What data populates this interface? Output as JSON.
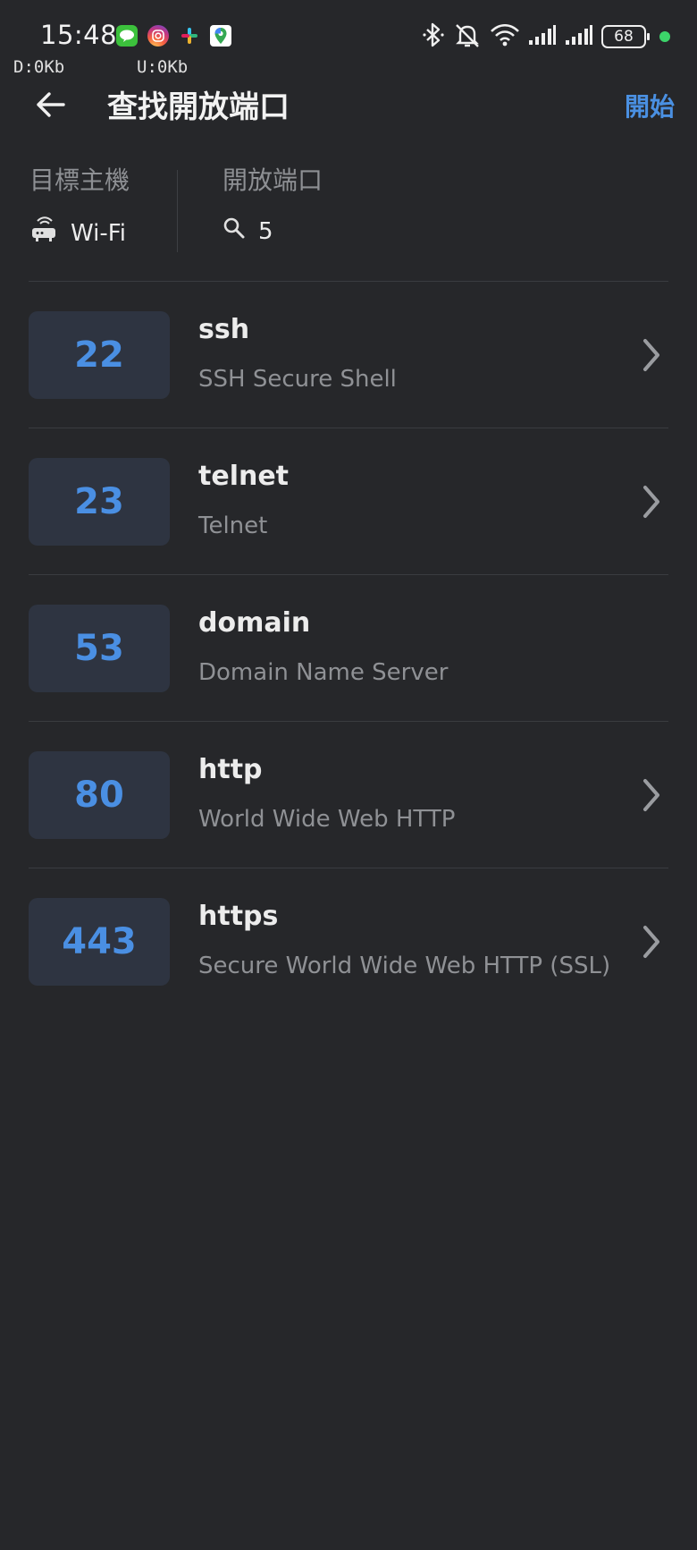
{
  "status_bar": {
    "time": "15:48",
    "battery": "68",
    "download_speed": "D:0Kb",
    "upload_speed": "U:0Kb",
    "notification_icons": [
      "line-icon",
      "instagram-icon",
      "slack-icon",
      "google-maps-icon"
    ],
    "system_icons": [
      "bluetooth-icon",
      "alarm-off-icon",
      "wifi-icon",
      "signal-icon",
      "signal-icon"
    ]
  },
  "app_bar": {
    "title": "查找開放端口",
    "action": "開始"
  },
  "info": {
    "target_label": "目標主機",
    "target_value": "Wi-Fi",
    "open_ports_label": "開放端口",
    "open_ports_value": "5"
  },
  "ports": [
    {
      "port": "22",
      "name": "ssh",
      "description": "SSH Secure Shell",
      "has_chevron": true
    },
    {
      "port": "23",
      "name": "telnet",
      "description": "Telnet",
      "has_chevron": true
    },
    {
      "port": "53",
      "name": "domain",
      "description": "Domain Name Server",
      "has_chevron": false
    },
    {
      "port": "80",
      "name": "http",
      "description": "World Wide Web HTTP",
      "has_chevron": true
    },
    {
      "port": "443",
      "name": "https",
      "description": "Secure World Wide Web HTTP (SSL)",
      "has_chevron": true
    }
  ],
  "colors": {
    "background": "#26272a",
    "accent": "#4a90e2",
    "badge_bg": "#2e3441"
  }
}
